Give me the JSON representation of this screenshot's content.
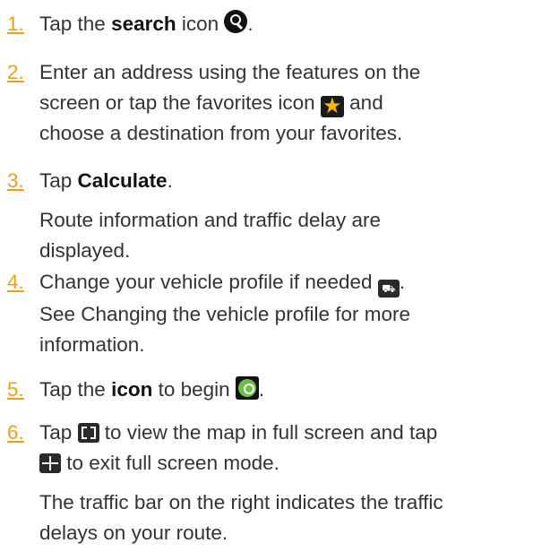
{
  "steps": [
    {
      "num": "1.",
      "pre": "Tap the ",
      "bold": "search",
      "post": " icon ",
      "end": "."
    },
    {
      "num": "2.",
      "line1": "Enter an address using the features on the",
      "line2": "screen or tap the favorites icon ",
      "line3": "choose a destination from your favorites.",
      "after_icon": " and"
    },
    {
      "num": "3.",
      "pre": "Tap ",
      "bold": "Calculate",
      "post": ".",
      "note1": "Route information and traffic delay are",
      "note2": "displayed."
    },
    {
      "num": "4.",
      "pre": "Change your vehicle profile if needed ",
      "end": ".",
      "note1": "See Changing the vehicle profile for more",
      "note2": "information."
    },
    {
      "num": "5.",
      "pre": "Tap the ",
      "bold": "icon",
      "post": " to begin ",
      "end": "."
    },
    {
      "num": "6.",
      "pre": "Tap ",
      "mid": " to view the map in full screen and tap",
      "line2": " to exit full screen mode.",
      "note1": "The traffic bar on the right indicates the traffic",
      "note2": "delays on your route."
    }
  ],
  "icons": [
    "search-icon",
    "favorites-star-icon",
    "vehicle-profile-icon",
    "start-navigation-icon",
    "fullscreen-icon",
    "exit-fullscreen-icon"
  ]
}
